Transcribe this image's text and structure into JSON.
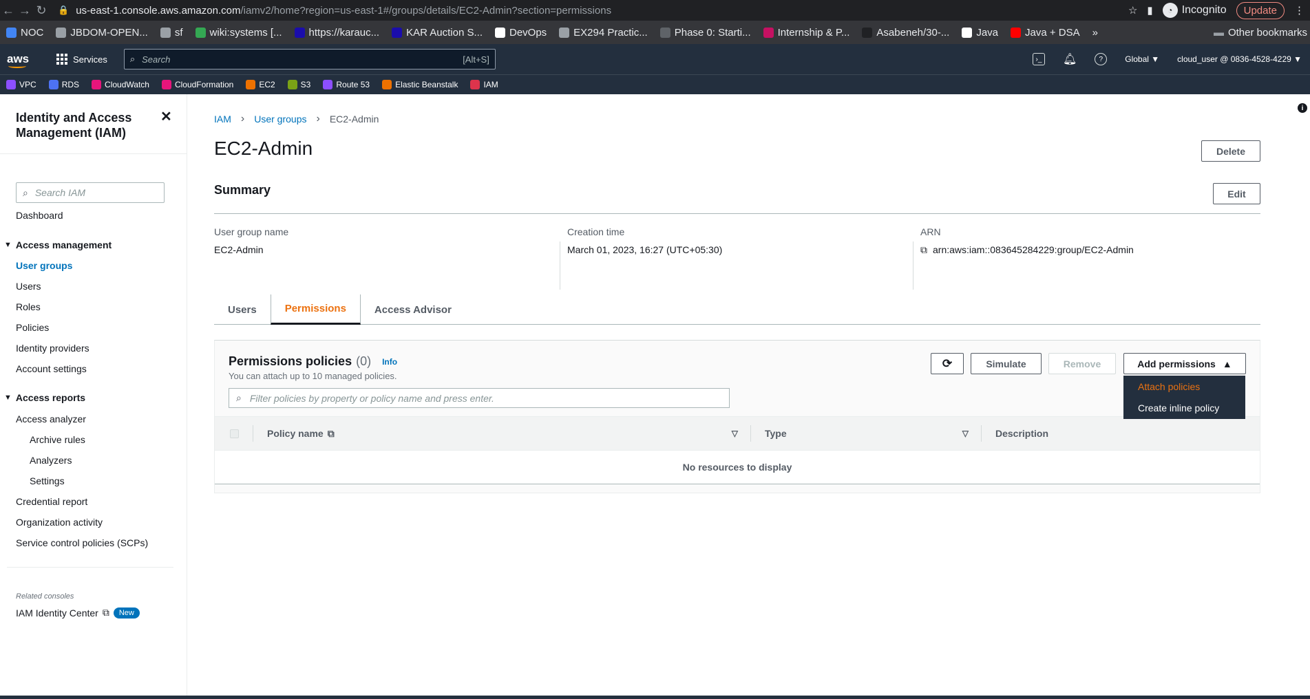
{
  "browser": {
    "url_host": "us-east-1.console.aws.amazon.com",
    "url_path": "/iamv2/home?region=us-east-1#/groups/details/EC2-Admin?section=permissions",
    "incognito_label": "Incognito",
    "update_label": "Update",
    "bookmarks": [
      {
        "label": "NOC",
        "color": "#4285f4"
      },
      {
        "label": "JBDOM-OPEN...",
        "color": "#9aa0a6"
      },
      {
        "label": "sf",
        "color": "#9aa0a6"
      },
      {
        "label": "wiki:systems [...",
        "color": "#34a853"
      },
      {
        "label": "https://karauc...",
        "color": "#1a0dab"
      },
      {
        "label": "KAR Auction S...",
        "color": "#1a0dab"
      },
      {
        "label": "DevOps",
        "color": "#ffffff"
      },
      {
        "label": "EX294 Practic...",
        "color": "#9aa0a6"
      },
      {
        "label": "Phase 0: Starti...",
        "color": "#5f6368"
      },
      {
        "label": "Internship & P...",
        "color": "#c51162"
      },
      {
        "label": "Asabeneh/30-...",
        "color": "#202124"
      },
      {
        "label": "Java",
        "color": "#ffffff"
      },
      {
        "label": "Java + DSA",
        "color": "#ff0000"
      }
    ],
    "more_label": "»",
    "other_bookmarks": "Other bookmarks"
  },
  "aws": {
    "logo": "aws",
    "services_label": "Services",
    "search_placeholder": "Search",
    "search_shortcut": "[Alt+S]",
    "region": "Global ▼",
    "account": "cloud_user @ 0836-4528-4229 ▼",
    "favorites": [
      {
        "label": "VPC",
        "color": "#8c4fff"
      },
      {
        "label": "RDS",
        "color": "#4d72f3"
      },
      {
        "label": "CloudWatch",
        "color": "#e7157b"
      },
      {
        "label": "CloudFormation",
        "color": "#e7157b"
      },
      {
        "label": "EC2",
        "color": "#ed7100"
      },
      {
        "label": "S3",
        "color": "#7aa116"
      },
      {
        "label": "Route 53",
        "color": "#8c4fff"
      },
      {
        "label": "Elastic Beanstalk",
        "color": "#ed7100"
      },
      {
        "label": "IAM",
        "color": "#dd344c"
      }
    ]
  },
  "sidebar": {
    "title": "Identity and Access Management (IAM)",
    "search_placeholder": "Search IAM",
    "dashboard": "Dashboard",
    "access_management": "Access management",
    "am_items": [
      "User groups",
      "Users",
      "Roles",
      "Policies",
      "Identity providers",
      "Account settings"
    ],
    "access_reports": "Access reports",
    "ar_items": [
      "Access analyzer",
      "Archive rules",
      "Analyzers",
      "Settings",
      "Credential report",
      "Organization activity",
      "Service control policies (SCPs)"
    ],
    "related_consoles": "Related consoles",
    "identity_center": "IAM Identity Center",
    "new_badge": "New"
  },
  "breadcrumb": {
    "iam": "IAM",
    "groups": "User groups",
    "current": "EC2-Admin"
  },
  "page": {
    "title": "EC2-Admin",
    "delete_label": "Delete",
    "summary_title": "Summary",
    "edit_label": "Edit",
    "group_name_label": "User group name",
    "group_name": "EC2-Admin",
    "creation_label": "Creation time",
    "creation_value": "March 01, 2023, 16:27 (UTC+05:30)",
    "arn_label": "ARN",
    "arn_value": "arn:aws:iam::083645284229:group/EC2-Admin"
  },
  "tabs": [
    "Users",
    "Permissions",
    "Access Advisor"
  ],
  "permissions": {
    "title": "Permissions policies",
    "count": "(0)",
    "info": "Info",
    "description": "You can attach up to 10 managed policies.",
    "simulate": "Simulate",
    "remove": "Remove",
    "add": "Add permissions",
    "filter_placeholder": "Filter policies by property or policy name and press enter.",
    "col_policy": "Policy name",
    "col_type": "Type",
    "col_desc": "Description",
    "empty": "No resources to display",
    "menu": [
      "Attach policies",
      "Create inline policy"
    ]
  }
}
